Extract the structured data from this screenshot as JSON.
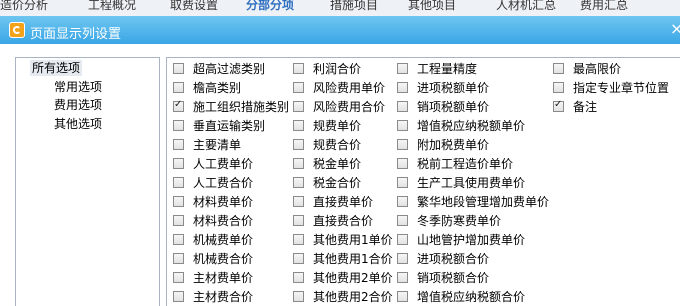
{
  "background_tabs": [
    {
      "label": "造价分析",
      "active": false
    },
    {
      "label": "工程概况",
      "active": false
    },
    {
      "label": "取费设置",
      "active": false
    },
    {
      "label": "分部分项",
      "active": true
    },
    {
      "label": "措施项目",
      "active": false
    },
    {
      "label": "其他项目",
      "active": false
    },
    {
      "label": "人材机汇总",
      "active": false
    },
    {
      "label": "费用汇总",
      "active": false
    }
  ],
  "dialog": {
    "title": "页面显示列设置",
    "close_glyph": "×"
  },
  "tree": [
    {
      "label": "所有选项",
      "selected": true
    },
    {
      "label": "常用选项",
      "selected": false
    },
    {
      "label": "费用选项",
      "selected": false
    },
    {
      "label": "其他选项",
      "selected": false
    }
  ],
  "columns": [
    [
      {
        "label": "超高过滤类别",
        "checked": false
      },
      {
        "label": "檐高类别",
        "checked": false
      },
      {
        "label": "施工组织措施类别",
        "checked": true
      },
      {
        "label": "垂直运输类别",
        "checked": false
      },
      {
        "label": "主要清单",
        "checked": false
      },
      {
        "label": "人工费单价",
        "checked": false
      },
      {
        "label": "人工费合价",
        "checked": false
      },
      {
        "label": "材料费单价",
        "checked": false
      },
      {
        "label": "材料费合价",
        "checked": false
      },
      {
        "label": "机械费单价",
        "checked": false
      },
      {
        "label": "机械费合价",
        "checked": false
      },
      {
        "label": "主材费单价",
        "checked": false
      },
      {
        "label": "主材费合价",
        "checked": false
      }
    ],
    [
      {
        "label": "利润合价",
        "checked": false
      },
      {
        "label": "风险费用单价",
        "checked": false
      },
      {
        "label": "风险费用合价",
        "checked": false
      },
      {
        "label": "规费单价",
        "checked": false
      },
      {
        "label": "规费合价",
        "checked": false
      },
      {
        "label": "税金单价",
        "checked": false
      },
      {
        "label": "税金合价",
        "checked": false
      },
      {
        "label": "直接费单价",
        "checked": false
      },
      {
        "label": "直接费合价",
        "checked": false
      },
      {
        "label": "其他费用1单价",
        "checked": false
      },
      {
        "label": "其他费用1合价",
        "checked": false
      },
      {
        "label": "其他费用2单价",
        "checked": false
      },
      {
        "label": "其他费用2合价",
        "checked": false
      }
    ],
    [
      {
        "label": "工程量精度",
        "checked": false
      },
      {
        "label": "进项税额单价",
        "checked": false
      },
      {
        "label": "销项税额单价",
        "checked": false
      },
      {
        "label": "增值税应纳税额单价",
        "checked": false
      },
      {
        "label": "附加税费单价",
        "checked": false
      },
      {
        "label": "税前工程造价单价",
        "checked": false
      },
      {
        "label": "生产工具使用费单价",
        "checked": false
      },
      {
        "label": "繁华地段管理增加费单价",
        "checked": false
      },
      {
        "label": "冬季防寒费单价",
        "checked": false
      },
      {
        "label": "山地管护增加费单价",
        "checked": false
      },
      {
        "label": "进项税额合价",
        "checked": false
      },
      {
        "label": "销项税额合价",
        "checked": false
      },
      {
        "label": "增值税应纳税额合价",
        "checked": false
      }
    ],
    [
      {
        "label": "最高限价",
        "checked": false
      },
      {
        "label": "指定专业章节位置",
        "checked": false
      },
      {
        "label": "备注",
        "checked": true
      }
    ]
  ]
}
